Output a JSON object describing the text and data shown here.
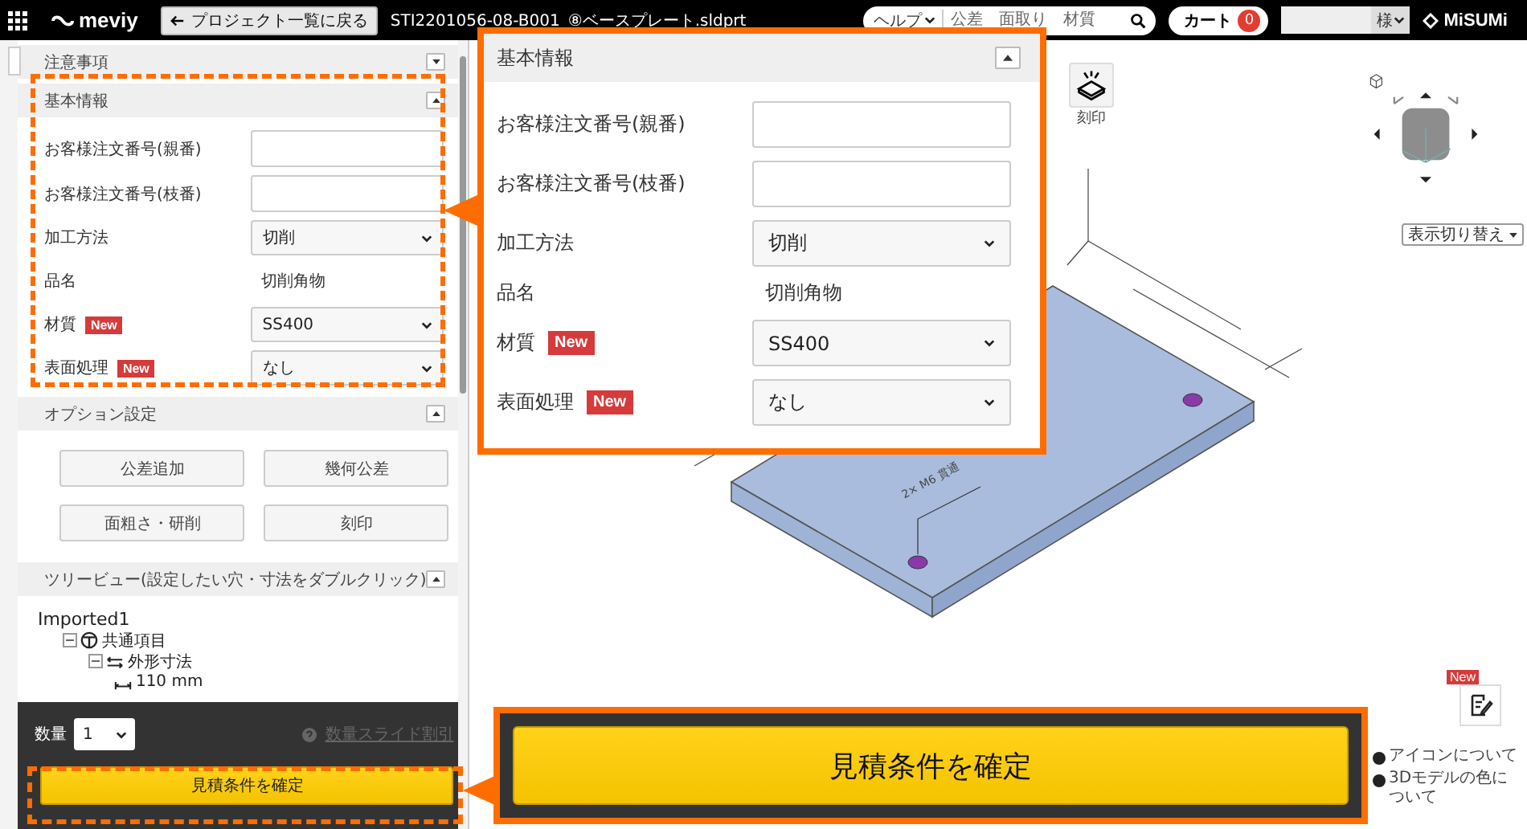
{
  "header": {
    "logo": "meviy",
    "back_button": "プロジェクト一覧に戻る",
    "file_name": "STI2201056-08-B001_⑧ベースプレート.sldprt",
    "search": {
      "category": "ヘルプ",
      "placeholder": "公差　面取り　材質"
    },
    "cart": {
      "label": "カート",
      "count": "0"
    },
    "user_suffix": "様",
    "brand": "MiSUMi"
  },
  "sidebar": {
    "notice": {
      "title": "注意事項",
      "expanded": false
    },
    "basic_info": {
      "title": "基本情報",
      "expanded": true,
      "fields": [
        {
          "label": "お客様注文番号(親番)",
          "kind": "input"
        },
        {
          "label": "お客様注文番号(枝番)",
          "kind": "input"
        },
        {
          "label": "加工方法",
          "kind": "select",
          "value": "切削"
        },
        {
          "label": "品名",
          "kind": "text",
          "value": "切削角物"
        },
        {
          "label": "材質",
          "kind": "select",
          "value": "SS400",
          "badge": "New"
        },
        {
          "label": "表面処理",
          "kind": "select",
          "value": "なし",
          "badge": "New"
        }
      ]
    },
    "options": {
      "title": "オプション設定",
      "expanded": true,
      "buttons": [
        "公差追加",
        "幾何公差",
        "面粗さ・研削",
        "刻印"
      ]
    },
    "tree_view": {
      "title": "ツリービュー(設定したい穴・寸法をダブルクリック)",
      "expanded": true,
      "tree": [
        {
          "label": "Imported1",
          "children": [
            {
              "label": "共通項目",
              "kind": "group",
              "expanded": true,
              "children": [
                {
                  "label": "外形寸法",
                  "kind": "dimensions",
                  "expanded": true,
                  "children": [
                    {
                      "label": "110 mm",
                      "kind": "dimension"
                    }
                  ]
                }
              ]
            }
          ]
        }
      ]
    },
    "footer": {
      "quantity_label": "数量",
      "quantity": "1",
      "discount_link": "数量スライド割引",
      "confirm_button": "見積条件を確定"
    }
  },
  "viewer": {
    "tool": "刻印",
    "view_switch": "表示切り替え",
    "model_note": "2× M6 貫通",
    "memo_badge": "New",
    "help_links": [
      "アイコンについて",
      "3Dモデルの色について"
    ]
  },
  "callout": {
    "title": "基本情報",
    "expanded": true,
    "fields": [
      {
        "label": "お客様注文番号(親番)",
        "kind": "input"
      },
      {
        "label": "お客様注文番号(枝番)",
        "kind": "input"
      },
      {
        "label": "加工方法",
        "kind": "select",
        "value": "切削"
      },
      {
        "label": "品名",
        "kind": "text",
        "value": "切削角物"
      },
      {
        "label": "材質",
        "kind": "select",
        "value": "SS400",
        "badge": "New"
      },
      {
        "label": "表面処理",
        "kind": "select",
        "value": "なし",
        "badge": "New"
      }
    ]
  },
  "callout_button": {
    "label": "見積条件を確定"
  }
}
